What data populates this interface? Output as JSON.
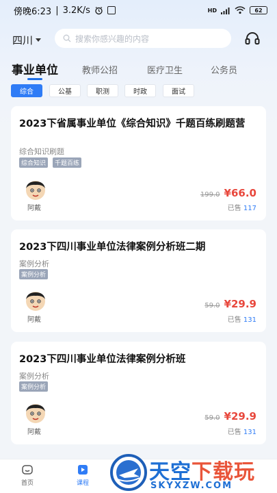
{
  "status_bar": {
    "time": "傍晚6:23",
    "speed": "3.2K/s",
    "network": "HD",
    "battery": "62"
  },
  "header": {
    "region": "四川",
    "search_placeholder": "搜索你感兴趣的内容"
  },
  "categories": [
    {
      "label": "事业单位",
      "active": true
    },
    {
      "label": "教师公招",
      "active": false
    },
    {
      "label": "医疗卫生",
      "active": false
    },
    {
      "label": "公务员",
      "active": false
    }
  ],
  "subjects": [
    {
      "label": "综合",
      "active": true
    },
    {
      "label": "公基",
      "active": false
    },
    {
      "label": "职测",
      "active": false
    },
    {
      "label": "时政",
      "active": false
    },
    {
      "label": "面试",
      "active": false
    }
  ],
  "courses": [
    {
      "title": "2023下省属事业单位《综合知识》千题百练刷题营",
      "subtitle": "综合知识刷题",
      "tags": [
        "综合知识",
        "千题百练"
      ],
      "teacher": "阿戴",
      "original_price": "199.0",
      "price": "¥66.0",
      "sold_label": "已售",
      "sold_count": "117"
    },
    {
      "title": "2023下四川事业单位法律案例分析班二期",
      "subtitle": "案例分析",
      "tags": [
        "案例分析"
      ],
      "teacher": "阿戴",
      "original_price": "59.0",
      "price": "¥29.9",
      "sold_label": "已售",
      "sold_count": "131"
    },
    {
      "title": "2023下四川事业单位法律案例分析班",
      "subtitle": "案例分析",
      "tags": [
        "案例分析"
      ],
      "teacher": "阿戴",
      "original_price": "59.0",
      "price": "¥29.9",
      "sold_label": "已售",
      "sold_count": "131"
    }
  ],
  "tabbar": {
    "home": "首页",
    "course": "课程"
  },
  "watermark": {
    "text_a": "天空",
    "text_b": "下载玩",
    "domain": "SKYXZW.COM"
  },
  "colors": {
    "accent": "#2f7cf6",
    "price": "#e8473c"
  }
}
